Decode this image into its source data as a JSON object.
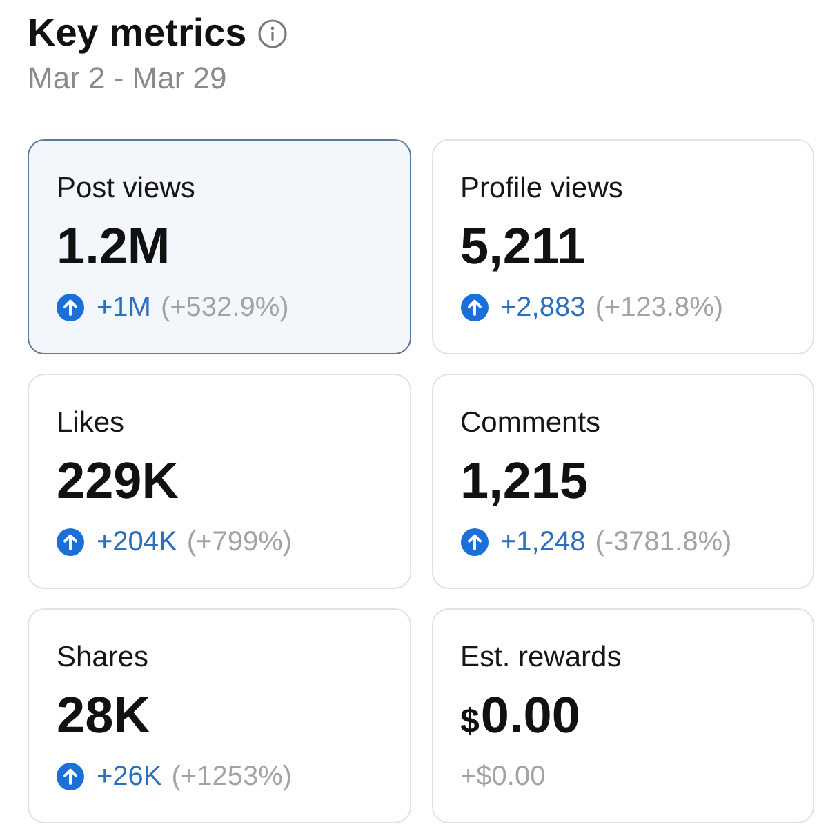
{
  "header": {
    "title": "Key metrics",
    "date_range": "Mar 2 - Mar 29"
  },
  "cards": [
    {
      "kind": "trend",
      "label": "Post views",
      "value": "1.2M",
      "selected": true,
      "change": {
        "amount": "+1M",
        "percent": "(+532.9%)"
      }
    },
    {
      "kind": "trend",
      "label": "Profile views",
      "value": "5,211",
      "selected": false,
      "change": {
        "amount": "+2,883",
        "percent": "(+123.8%)"
      }
    },
    {
      "kind": "trend",
      "label": "Likes",
      "value": "229K",
      "selected": false,
      "change": {
        "amount": "+204K",
        "percent": "(+799%)"
      }
    },
    {
      "kind": "trend",
      "label": "Comments",
      "value": "1,215",
      "selected": false,
      "change": {
        "amount": "+1,248",
        "percent": "(-3781.8%)"
      }
    },
    {
      "kind": "trend",
      "label": "Shares",
      "value": "28K",
      "selected": false,
      "change": {
        "amount": "+26K",
        "percent": "(+1253%)"
      }
    },
    {
      "kind": "money",
      "label": "Est. rewards",
      "currency": "$",
      "value": "0.00",
      "selected": false,
      "change": {
        "amount": "+$0.00"
      }
    }
  ]
}
